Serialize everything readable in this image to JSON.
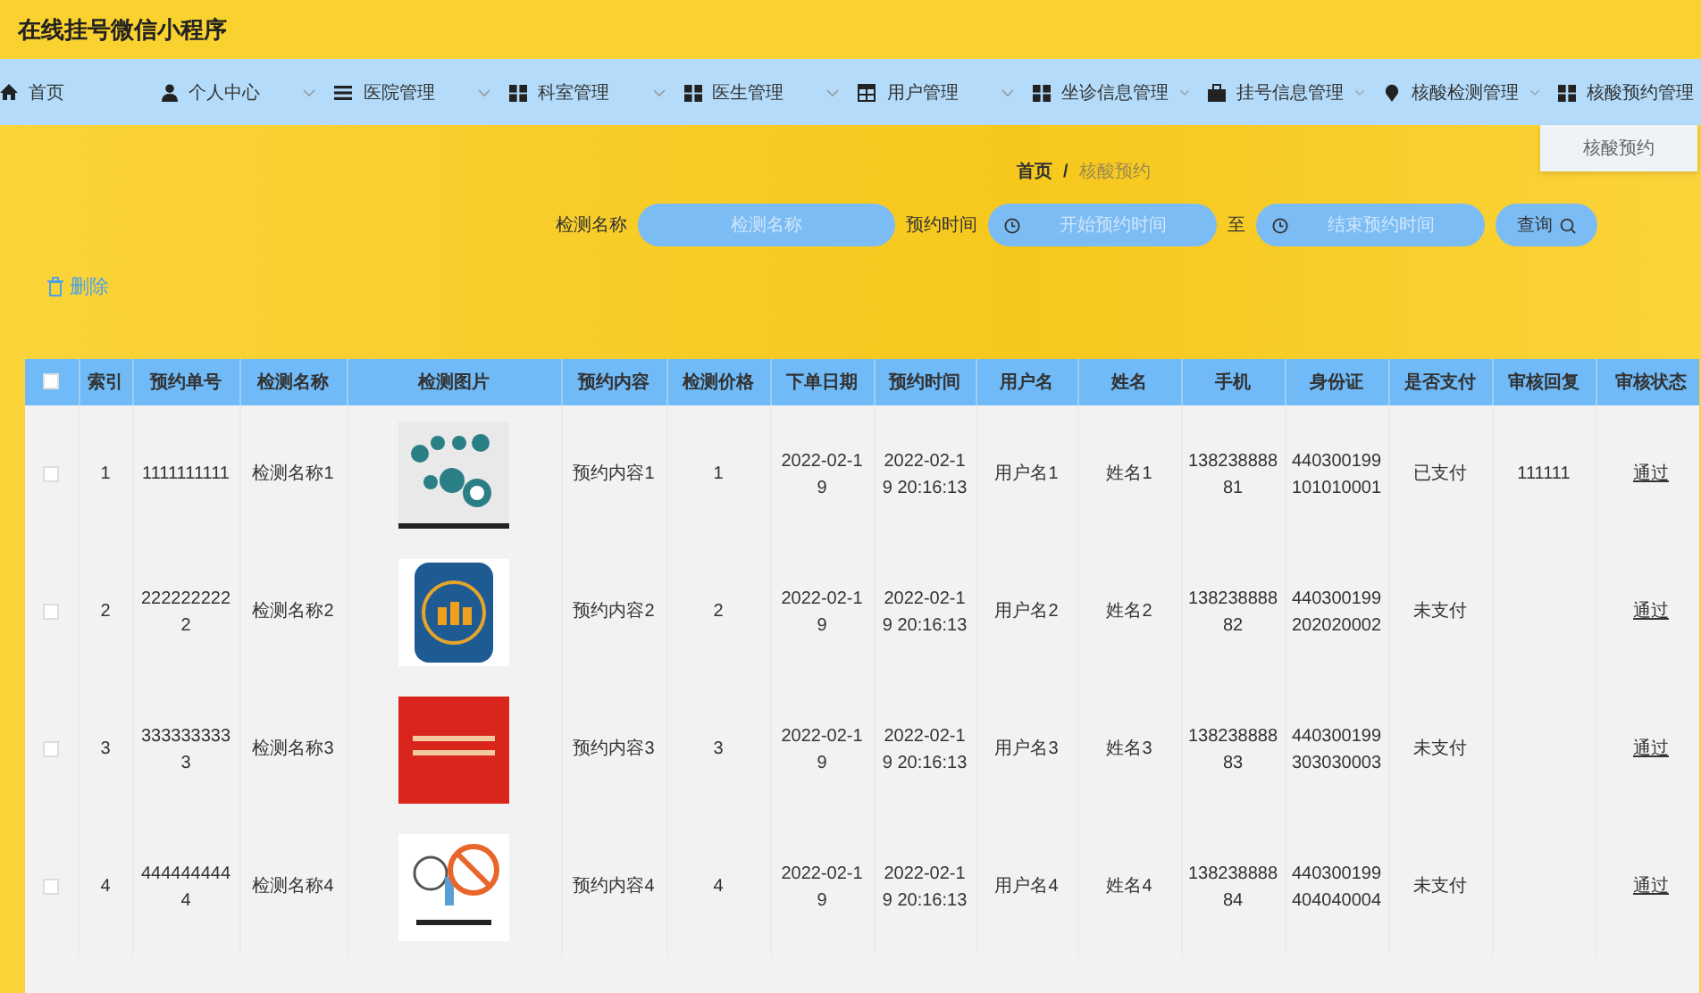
{
  "app_title": "在线挂号微信小程序",
  "nav": [
    {
      "label": "首页",
      "kind": "link"
    },
    {
      "label": "个人中心",
      "kind": "menu"
    },
    {
      "label": "医院管理",
      "kind": "menu"
    },
    {
      "label": "科室管理",
      "kind": "menu"
    },
    {
      "label": "医生管理",
      "kind": "menu"
    },
    {
      "label": "用户管理",
      "kind": "menu"
    },
    {
      "label": "坐诊信息管理",
      "kind": "menu"
    },
    {
      "label": "挂号信息管理",
      "kind": "menu"
    },
    {
      "label": "核酸检测管理",
      "kind": "menu"
    },
    {
      "label": "核酸预约管理",
      "kind": "menu",
      "submenu": [
        "核酸预约"
      ]
    }
  ],
  "breadcrumb": {
    "items": [
      "首页",
      "核酸预约"
    ],
    "separator": "/"
  },
  "search": {
    "name_label": "检测名称",
    "name_placeholder": "检测名称",
    "time_label": "预约时间",
    "start_placeholder": "开始预约时间",
    "to_label": "至",
    "end_placeholder": "结束预约时间",
    "button": "查询"
  },
  "delete_button": "删除",
  "table": {
    "all_checked": false,
    "columns": [
      "索引",
      "预约单号",
      "检测名称",
      "检测图片",
      "预约内容",
      "检测价格",
      "下单日期",
      "预约时间",
      "用户名",
      "姓名",
      "手机",
      "身份证",
      "是否支付",
      "审核回复",
      "审核状态"
    ],
    "rows": [
      {
        "checked": false,
        "kind": "icons",
        "cells": [
          "1",
          "1111111111",
          "检测名称1",
          null,
          "预约内容1",
          "1",
          "2022-02-19",
          "2022-02-19 20:16:13",
          "用户名1",
          "姓名1",
          "13823888881",
          "440300199101010001",
          "已支付",
          "111111",
          "通过"
        ]
      },
      {
        "checked": false,
        "kind": "badge",
        "cells": [
          "2",
          "2222222222",
          "检测名称2",
          null,
          "预约内容2",
          "2",
          "2022-02-19",
          "2022-02-19 20:16:13",
          "用户名2",
          "姓名2",
          "13823888882",
          "440300199202020002",
          "未支付",
          null,
          "通过"
        ]
      },
      {
        "checked": false,
        "kind": "poster",
        "cells": [
          "3",
          "3333333333",
          "检测名称3",
          null,
          "预约内容3",
          "3",
          "2022-02-19",
          "2022-02-19 20:16:13",
          "用户名3",
          "姓名3",
          "13823888883",
          "440300199303030003",
          "未支付",
          null,
          "通过"
        ]
      },
      {
        "checked": false,
        "kind": "sign",
        "cells": [
          "4",
          "4444444444",
          "检测名称4",
          null,
          "预约内容4",
          "4",
          "2022-02-19",
          "2022-02-19 20:16:13",
          "用户名4",
          "姓名4",
          "13823888884",
          "440300199404040004",
          "未支付",
          null,
          "通过"
        ]
      }
    ]
  }
}
